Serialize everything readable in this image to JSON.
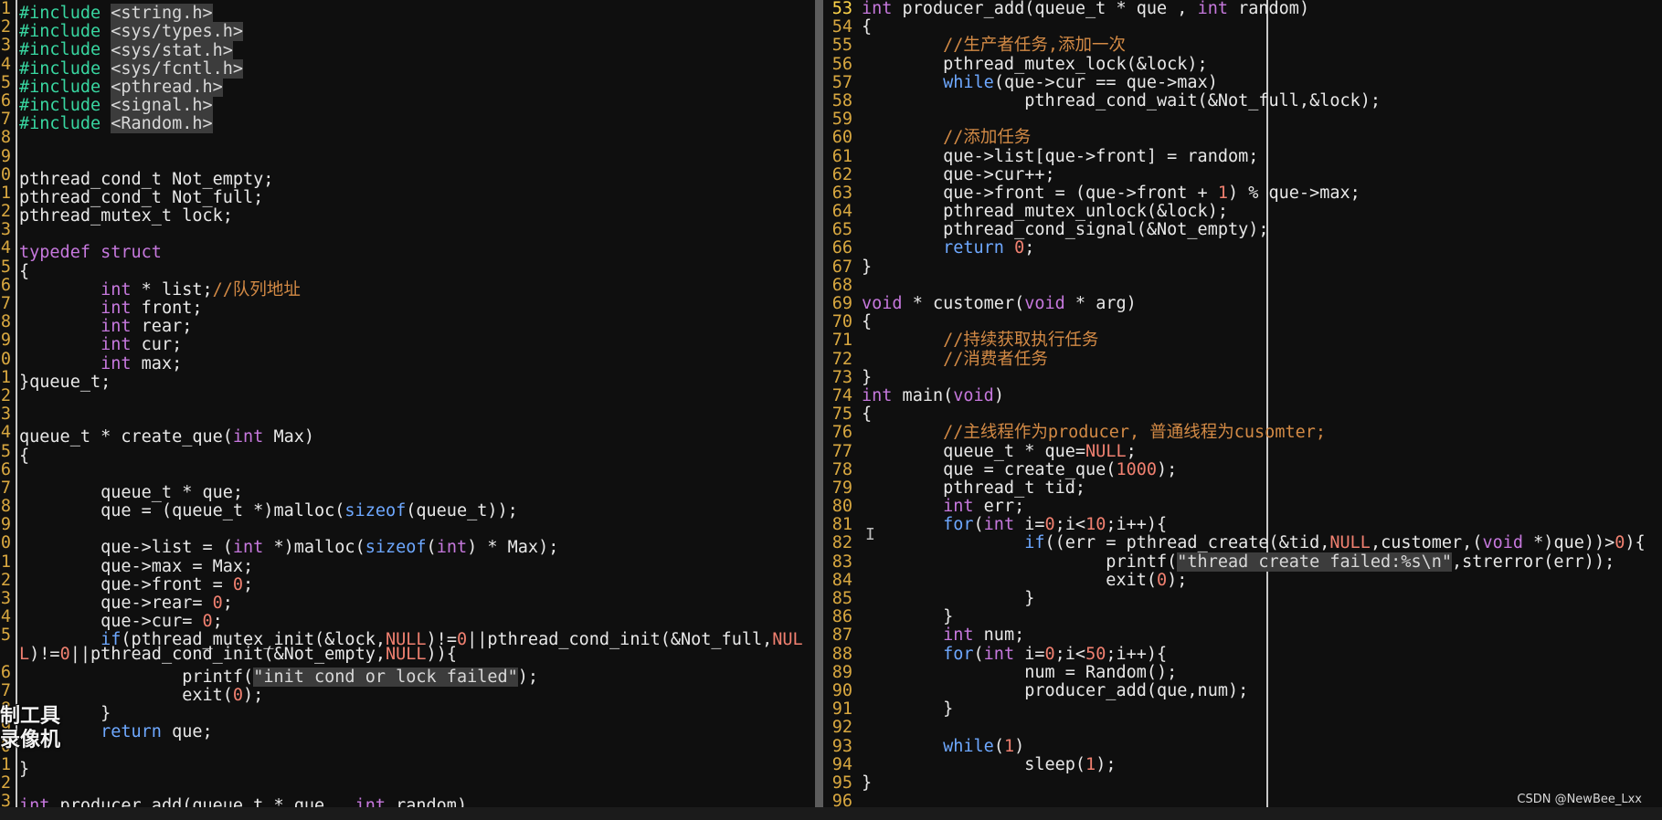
{
  "colors": {
    "background": "#0f0f0f",
    "line_number": "#d9a840",
    "plain": "#e8e8e8",
    "keyword": "#c678dd",
    "type": "#6ea8ff",
    "string": "#d8d8d8",
    "string_bg": "#3c3c3c",
    "number": "#f08070",
    "comment": "#d38a45",
    "include": "#38d6a0"
  },
  "left_pane": {
    "lines": [
      {
        "n": "1",
        "tokens": [
          {
            "t": "#include",
            "c": "include"
          },
          {
            "t": " "
          },
          {
            "t": "<string.h>",
            "c": "string"
          }
        ]
      },
      {
        "n": "2",
        "tokens": [
          {
            "t": "#include",
            "c": "include"
          },
          {
            "t": " "
          },
          {
            "t": "<sys/types.h>",
            "c": "string"
          }
        ]
      },
      {
        "n": "3",
        "tokens": [
          {
            "t": "#include",
            "c": "include"
          },
          {
            "t": " "
          },
          {
            "t": "<sys/stat.h>",
            "c": "string"
          }
        ]
      },
      {
        "n": "4",
        "tokens": [
          {
            "t": "#include",
            "c": "include"
          },
          {
            "t": " "
          },
          {
            "t": "<sys/fcntl.h>",
            "c": "string"
          }
        ]
      },
      {
        "n": "5",
        "tokens": [
          {
            "t": "#include",
            "c": "include"
          },
          {
            "t": " "
          },
          {
            "t": "<pthread.h>",
            "c": "string"
          }
        ]
      },
      {
        "n": "6",
        "tokens": [
          {
            "t": "#include",
            "c": "include"
          },
          {
            "t": " "
          },
          {
            "t": "<signal.h>",
            "c": "string"
          }
        ]
      },
      {
        "n": "7",
        "tokens": [
          {
            "t": "#include",
            "c": "include"
          },
          {
            "t": " "
          },
          {
            "t": "<Random.h>",
            "c": "string"
          }
        ]
      },
      {
        "n": "8",
        "tokens": []
      },
      {
        "n": "9",
        "tokens": []
      },
      {
        "n": "0",
        "tokens": [
          {
            "t": "pthread_cond_t Not_empty;"
          }
        ]
      },
      {
        "n": "1",
        "tokens": [
          {
            "t": "pthread_cond_t Not_full;"
          }
        ]
      },
      {
        "n": "2",
        "tokens": [
          {
            "t": "pthread_mutex_t lock;"
          }
        ]
      },
      {
        "n": "3",
        "tokens": []
      },
      {
        "n": "4",
        "tokens": [
          {
            "t": "typedef",
            "c": "keyword"
          },
          {
            "t": " "
          },
          {
            "t": "struct",
            "c": "keyword"
          }
        ]
      },
      {
        "n": "5",
        "tokens": [
          {
            "t": "{"
          }
        ]
      },
      {
        "n": "6",
        "tokens": [
          {
            "t": "        "
          },
          {
            "t": "int",
            "c": "keyword"
          },
          {
            "t": " * list;"
          },
          {
            "t": "//队列地址",
            "c": "comment"
          }
        ]
      },
      {
        "n": "7",
        "tokens": [
          {
            "t": "        "
          },
          {
            "t": "int",
            "c": "keyword"
          },
          {
            "t": " front;"
          }
        ]
      },
      {
        "n": "8",
        "tokens": [
          {
            "t": "        "
          },
          {
            "t": "int",
            "c": "keyword"
          },
          {
            "t": " rear;"
          }
        ]
      },
      {
        "n": "9",
        "tokens": [
          {
            "t": "        "
          },
          {
            "t": "int",
            "c": "keyword"
          },
          {
            "t": " cur;"
          }
        ]
      },
      {
        "n": "0",
        "tokens": [
          {
            "t": "        "
          },
          {
            "t": "int",
            "c": "keyword"
          },
          {
            "t": " max;"
          }
        ]
      },
      {
        "n": "1",
        "tokens": [
          {
            "t": "}queue_t;"
          }
        ]
      },
      {
        "n": "2",
        "tokens": []
      },
      {
        "n": "3",
        "tokens": []
      },
      {
        "n": "4",
        "tokens": [
          {
            "t": "queue_t * create_que("
          },
          {
            "t": "int",
            "c": "keyword"
          },
          {
            "t": " Max)"
          }
        ]
      },
      {
        "n": "5",
        "tokens": [
          {
            "t": "{"
          }
        ]
      },
      {
        "n": "6",
        "tokens": []
      },
      {
        "n": "7",
        "tokens": [
          {
            "t": "        queue_t * que;"
          }
        ]
      },
      {
        "n": "8",
        "tokens": [
          {
            "t": "        que = (queue_t *)malloc("
          },
          {
            "t": "sizeof",
            "c": "type"
          },
          {
            "t": "(queue_t));"
          }
        ]
      },
      {
        "n": "9",
        "tokens": []
      },
      {
        "n": "0",
        "tokens": [
          {
            "t": "        que->list = ("
          },
          {
            "t": "int",
            "c": "keyword"
          },
          {
            "t": " *)malloc("
          },
          {
            "t": "sizeof",
            "c": "type"
          },
          {
            "t": "("
          },
          {
            "t": "int",
            "c": "keyword"
          },
          {
            "t": ") * Max);"
          }
        ]
      },
      {
        "n": "1",
        "tokens": [
          {
            "t": "        que->max = Max;"
          }
        ]
      },
      {
        "n": "2",
        "tokens": [
          {
            "t": "        que->front = "
          },
          {
            "t": "0",
            "c": "number"
          },
          {
            "t": ";"
          }
        ]
      },
      {
        "n": "3",
        "tokens": [
          {
            "t": "        que->rear= "
          },
          {
            "t": "0",
            "c": "number"
          },
          {
            "t": ";"
          }
        ]
      },
      {
        "n": "4",
        "tokens": [
          {
            "t": "        que->cur= "
          },
          {
            "t": "0",
            "c": "number"
          },
          {
            "t": ";"
          }
        ]
      },
      {
        "n": "5",
        "tokens": [
          {
            "t": "        "
          },
          {
            "t": "if",
            "c": "type"
          },
          {
            "t": "(pthread_mutex_init(&lock,"
          },
          {
            "t": "NULL",
            "c": "number"
          },
          {
            "t": ")!="
          },
          {
            "t": "0",
            "c": "number"
          },
          {
            "t": "||pthread_cond_init(&Not_full,"
          },
          {
            "t": "NUL",
            "c": "number"
          }
        ]
      },
      {
        "n": "",
        "tokens": [
          {
            "t": "L",
            "c": "number"
          },
          {
            "t": ")!="
          },
          {
            "t": "0",
            "c": "number"
          },
          {
            "t": "||pthread_cond_init(&Not_empty,"
          },
          {
            "t": "NULL",
            "c": "number"
          },
          {
            "t": ")){"
          }
        ]
      },
      {
        "n": "6",
        "tokens": [
          {
            "t": "                printf("
          },
          {
            "t": "\"init cond or lock failed\"",
            "c": "string"
          },
          {
            "t": ");"
          }
        ]
      },
      {
        "n": "7",
        "tokens": [
          {
            "t": "                exit("
          },
          {
            "t": "0",
            "c": "number"
          },
          {
            "t": ");"
          }
        ]
      },
      {
        "n": "8",
        "tokens": [
          {
            "t": "        }"
          }
        ]
      },
      {
        "n": "9",
        "tokens": [
          {
            "t": "        "
          },
          {
            "t": "return",
            "c": "type"
          },
          {
            "t": " que;"
          }
        ]
      },
      {
        "n": "0",
        "tokens": []
      },
      {
        "n": "1",
        "tokens": [
          {
            "t": "}"
          }
        ]
      },
      {
        "n": "2",
        "tokens": []
      },
      {
        "n": "3",
        "tokens": [
          {
            "t": "int",
            "c": "keyword"
          },
          {
            "t": " producer_add(queue_t * que , "
          },
          {
            "t": "int",
            "c": "keyword"
          },
          {
            "t": " random)"
          }
        ]
      }
    ]
  },
  "right_pane": {
    "lines": [
      {
        "n": "53",
        "tokens": [
          {
            "t": "int",
            "c": "keyword"
          },
          {
            "t": " producer_add(queue_t * que , "
          },
          {
            "t": "int",
            "c": "keyword"
          },
          {
            "t": " random)"
          }
        ]
      },
      {
        "n": "54",
        "tokens": [
          {
            "t": "{"
          }
        ]
      },
      {
        "n": "55",
        "tokens": [
          {
            "t": "        "
          },
          {
            "t": "//生产者任务,添加一次",
            "c": "comment"
          }
        ]
      },
      {
        "n": "56",
        "tokens": [
          {
            "t": "        pthread_mutex_lock(&lock);"
          }
        ]
      },
      {
        "n": "57",
        "tokens": [
          {
            "t": "        "
          },
          {
            "t": "while",
            "c": "type"
          },
          {
            "t": "(que->cur == que->max)"
          }
        ]
      },
      {
        "n": "58",
        "tokens": [
          {
            "t": "                pthread_cond_wait(&Not_full,&lock);"
          }
        ]
      },
      {
        "n": "59",
        "tokens": []
      },
      {
        "n": "60",
        "tokens": [
          {
            "t": "        "
          },
          {
            "t": "//添加任务",
            "c": "comment"
          }
        ]
      },
      {
        "n": "61",
        "tokens": [
          {
            "t": "        que->list[que->front] = random;"
          }
        ]
      },
      {
        "n": "62",
        "tokens": [
          {
            "t": "        que->cur++;"
          }
        ]
      },
      {
        "n": "63",
        "tokens": [
          {
            "t": "        que->front = (que->front + "
          },
          {
            "t": "1",
            "c": "number"
          },
          {
            "t": ") % que->max;"
          }
        ]
      },
      {
        "n": "64",
        "tokens": [
          {
            "t": "        pthread_mutex_unlock(&lock);"
          }
        ]
      },
      {
        "n": "65",
        "tokens": [
          {
            "t": "        pthread_cond_signal(&Not_empty);"
          }
        ]
      },
      {
        "n": "66",
        "tokens": [
          {
            "t": "        "
          },
          {
            "t": "return",
            "c": "type"
          },
          {
            "t": " "
          },
          {
            "t": "0",
            "c": "number"
          },
          {
            "t": ";"
          }
        ]
      },
      {
        "n": "67",
        "tokens": [
          {
            "t": "}"
          }
        ]
      },
      {
        "n": "68",
        "tokens": []
      },
      {
        "n": "69",
        "tokens": [
          {
            "t": "void",
            "c": "keyword"
          },
          {
            "t": " * customer("
          },
          {
            "t": "void",
            "c": "keyword"
          },
          {
            "t": " * arg)"
          }
        ]
      },
      {
        "n": "70",
        "tokens": [
          {
            "t": "{"
          }
        ]
      },
      {
        "n": "71",
        "tokens": [
          {
            "t": "        "
          },
          {
            "t": "//持续获取执行任务",
            "c": "comment"
          }
        ]
      },
      {
        "n": "72",
        "tokens": [
          {
            "t": "        "
          },
          {
            "t": "//消费者任务",
            "c": "comment"
          }
        ]
      },
      {
        "n": "73",
        "tokens": [
          {
            "t": "}"
          }
        ]
      },
      {
        "n": "74",
        "tokens": [
          {
            "t": "int",
            "c": "keyword"
          },
          {
            "t": " main("
          },
          {
            "t": "void",
            "c": "keyword"
          },
          {
            "t": ")"
          }
        ]
      },
      {
        "n": "75",
        "tokens": [
          {
            "t": "{"
          }
        ]
      },
      {
        "n": "76",
        "tokens": [
          {
            "t": "        "
          },
          {
            "t": "//主线程作为producer, 普通线程为cusomter;",
            "c": "comment"
          }
        ]
      },
      {
        "n": "77",
        "tokens": [
          {
            "t": "        queue_t * que="
          },
          {
            "t": "NULL",
            "c": "number"
          },
          {
            "t": ";"
          }
        ]
      },
      {
        "n": "78",
        "tokens": [
          {
            "t": "        que = create_que("
          },
          {
            "t": "1000",
            "c": "number"
          },
          {
            "t": ");"
          }
        ]
      },
      {
        "n": "79",
        "tokens": [
          {
            "t": "        pthread_t tid;"
          }
        ]
      },
      {
        "n": "80",
        "tokens": [
          {
            "t": "        "
          },
          {
            "t": "int",
            "c": "keyword"
          },
          {
            "t": " err;"
          }
        ]
      },
      {
        "n": "81",
        "tokens": [
          {
            "t": "        "
          },
          {
            "t": "for",
            "c": "type"
          },
          {
            "t": "("
          },
          {
            "t": "int",
            "c": "keyword"
          },
          {
            "t": " i="
          },
          {
            "t": "0",
            "c": "number"
          },
          {
            "t": ";i<"
          },
          {
            "t": "10",
            "c": "number"
          },
          {
            "t": ";i++){"
          }
        ]
      },
      {
        "n": "82",
        "tokens": [
          {
            "t": "                "
          },
          {
            "t": "if",
            "c": "type"
          },
          {
            "t": "((err = pthread_create(&tid,"
          },
          {
            "t": "NULL",
            "c": "number"
          },
          {
            "t": ",customer,("
          },
          {
            "t": "void",
            "c": "keyword"
          },
          {
            "t": " *)que))>"
          },
          {
            "t": "0",
            "c": "number"
          },
          {
            "t": "){"
          }
        ]
      },
      {
        "n": "83",
        "tokens": [
          {
            "t": "                        printf("
          },
          {
            "t": "\"thread create failed:%s\\n\"",
            "c": "string"
          },
          {
            "t": ",strerror(err));"
          }
        ]
      },
      {
        "n": "84",
        "tokens": [
          {
            "t": "                        exit("
          },
          {
            "t": "0",
            "c": "number"
          },
          {
            "t": ");"
          }
        ]
      },
      {
        "n": "85",
        "tokens": [
          {
            "t": "                }"
          }
        ]
      },
      {
        "n": "86",
        "tokens": [
          {
            "t": "        }"
          }
        ]
      },
      {
        "n": "87",
        "tokens": [
          {
            "t": "        "
          },
          {
            "t": "int",
            "c": "keyword"
          },
          {
            "t": " num;"
          }
        ]
      },
      {
        "n": "88",
        "tokens": [
          {
            "t": "        "
          },
          {
            "t": "for",
            "c": "type"
          },
          {
            "t": "("
          },
          {
            "t": "int",
            "c": "keyword"
          },
          {
            "t": " i="
          },
          {
            "t": "0",
            "c": "number"
          },
          {
            "t": ";i<"
          },
          {
            "t": "50",
            "c": "number"
          },
          {
            "t": ";i++){"
          }
        ]
      },
      {
        "n": "89",
        "tokens": [
          {
            "t": "                num = Random();"
          }
        ]
      },
      {
        "n": "90",
        "tokens": [
          {
            "t": "                producer_add(que,num);"
          }
        ]
      },
      {
        "n": "91",
        "tokens": [
          {
            "t": "        }"
          }
        ]
      },
      {
        "n": "92",
        "tokens": []
      },
      {
        "n": "93",
        "tokens": [
          {
            "t": "        "
          },
          {
            "t": "while",
            "c": "type"
          },
          {
            "t": "("
          },
          {
            "t": "1",
            "c": "number"
          },
          {
            "t": ")"
          }
        ]
      },
      {
        "n": "94",
        "tokens": [
          {
            "t": "                sleep("
          },
          {
            "t": "1",
            "c": "number"
          },
          {
            "t": ");"
          }
        ]
      },
      {
        "n": "95",
        "tokens": [
          {
            "t": "}"
          }
        ]
      },
      {
        "n": "96",
        "tokens": []
      }
    ]
  },
  "overlay": {
    "stamp_line1": "制工具",
    "stamp_line2": "录像机"
  },
  "watermark": "CSDN @NewBee_Lxx",
  "caret_glyph": "I"
}
